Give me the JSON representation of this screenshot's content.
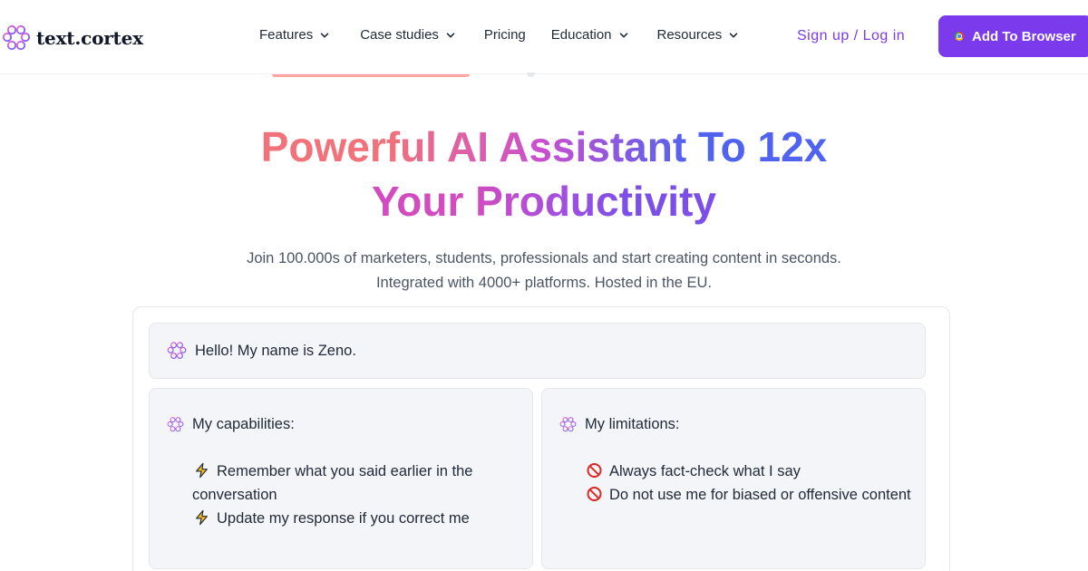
{
  "nav": {
    "logo_text": "text.cortex",
    "logo_icon": "brain-icon",
    "menu": [
      {
        "label": "Features",
        "has_dropdown": true
      },
      {
        "label": "Case studies",
        "has_dropdown": true
      },
      {
        "label": "Pricing",
        "has_dropdown": false
      },
      {
        "label": "Education",
        "has_dropdown": true
      },
      {
        "label": "Resources",
        "has_dropdown": true
      }
    ],
    "login_label": "Sign up / Log in",
    "cta_label": "Add To Browser",
    "cta_icon": "chrome-icon"
  },
  "hero": {
    "title_line1": "Powerful AI Assistant To 12x",
    "title_line2": "Your Productivity",
    "subtitle_line1": "Join 100.000s of marketers, students, professionals and start creating content in seconds.",
    "subtitle_line2": "Integrated with 4000+ platforms. Hosted in the EU."
  },
  "chat": {
    "greeting": "Hello! My name is Zeno.",
    "capabilities": {
      "title": "My capabilities:",
      "icon": "lightning-icon",
      "items": [
        "Remember what you said earlier in the conversation",
        "Update my response if you correct me"
      ]
    },
    "limitations": {
      "title": "My limitations:",
      "icon": "prohibited-icon",
      "items": [
        "Always fact-check what I say",
        "Do not use me for biased or offensive content"
      ]
    }
  },
  "colors": {
    "brand": "#7c3aed",
    "gradient_start": "#f1727a",
    "gradient_mid": "#c84fd0",
    "gradient_end": "#4f63f0",
    "panel_bg": "#f4f5f8"
  }
}
